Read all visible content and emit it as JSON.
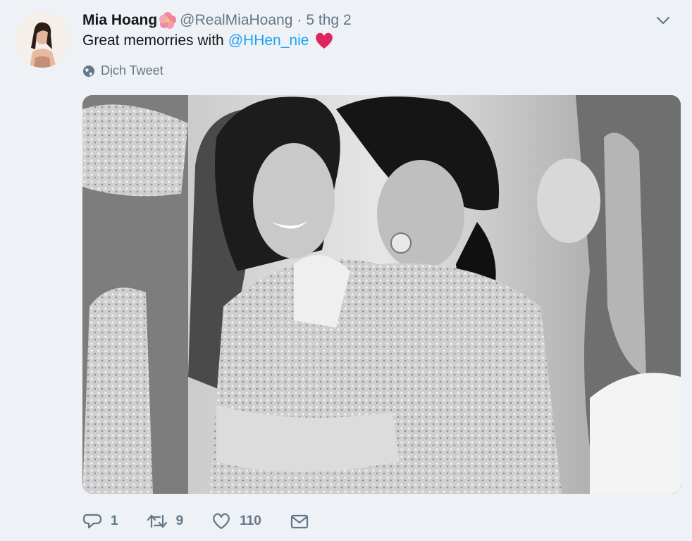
{
  "tweet": {
    "author_name": "Mia Hoang",
    "author_handle": "@RealMiaHoang",
    "separator": "·",
    "timestamp": "5 thg 2",
    "text_prefix": "Great memorries with",
    "mention": "@HHen_nie",
    "translate_label": "Dịch Tweet"
  },
  "actions": {
    "reply_count": "1",
    "retweet_count": "9",
    "like_count": "110"
  },
  "icons": {
    "avatar": "avatar",
    "flower": "hibiscus-flower-emoji",
    "heart": "red-heart-emoji",
    "more": "chevron-down-icon",
    "translate": "globe-icon",
    "reply": "reply-icon",
    "retweet": "retweet-icon",
    "like": "heart-outline-icon",
    "message": "envelope-icon"
  },
  "colors": {
    "link": "#1da1f2",
    "muted": "#657786",
    "heart": "#e0245e",
    "background": "#eef2f6"
  }
}
